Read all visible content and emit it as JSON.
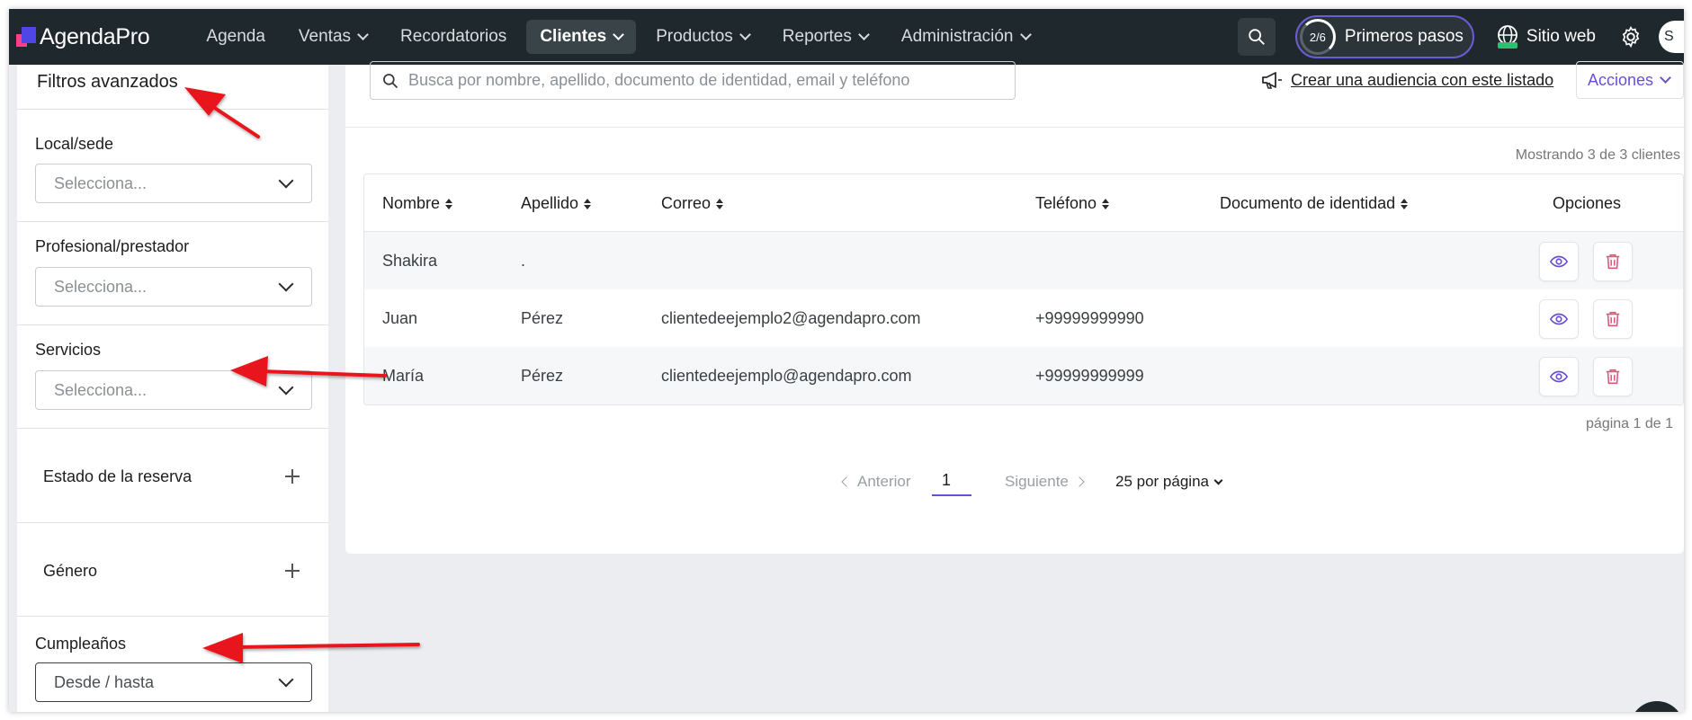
{
  "brand": "AgendaPro",
  "nav": {
    "items": [
      {
        "label": "Agenda",
        "dropdown": false,
        "active": false
      },
      {
        "label": "Ventas",
        "dropdown": true,
        "active": false
      },
      {
        "label": "Recordatorios",
        "dropdown": false,
        "active": false
      },
      {
        "label": "Clientes",
        "dropdown": true,
        "active": true
      },
      {
        "label": "Productos",
        "dropdown": true,
        "active": false
      },
      {
        "label": "Reportes",
        "dropdown": true,
        "active": false
      },
      {
        "label": "Administración",
        "dropdown": true,
        "active": false
      }
    ],
    "steps_progress": "2/6",
    "steps_label": "Primeros pasos",
    "site_label": "Sitio web",
    "avatar_initial": "S"
  },
  "sidebar": {
    "title": "Filtros avanzados",
    "local_label": "Local/sede",
    "local_placeholder": "Selecciona...",
    "profesional_label": "Profesional/prestador",
    "profesional_placeholder": "Selecciona...",
    "servicios_label": "Servicios",
    "servicios_placeholder": "Selecciona...",
    "estado_label": "Estado de la reserva",
    "genero_label": "Género",
    "cumple_label": "Cumpleaños",
    "cumple_value": "Desde / hasta"
  },
  "main": {
    "search_placeholder": "Busca por nombre, apellido, documento de identidad, email y teléfono",
    "audience_link": "Crear una audiencia con este listado",
    "actions_label": "Acciones",
    "showing": "Mostrando 3 de 3 clientes",
    "columns": {
      "nombre": "Nombre",
      "apellido": "Apellido",
      "correo": "Correo",
      "telefono": "Teléfono",
      "documento": "Documento de identidad",
      "opciones": "Opciones"
    },
    "rows": [
      {
        "nombre": "Shakira",
        "apellido": ".",
        "correo": "",
        "telefono": "",
        "documento": ""
      },
      {
        "nombre": "Juan",
        "apellido": "Pérez",
        "correo": "clientedeejemplo2@agendapro.com",
        "telefono": "+99999999990",
        "documento": ""
      },
      {
        "nombre": "María",
        "apellido": "Pérez",
        "correo": "clientedeejemplo@agendapro.com",
        "telefono": "+99999999999",
        "documento": ""
      }
    ],
    "page_info": "página 1 de 1",
    "pager": {
      "prev": "Anterior",
      "current": "1",
      "next": "Siguiente",
      "per_page": "25 por página"
    }
  },
  "colors": {
    "topbar": "#1f282c",
    "accent": "#6b4fd1",
    "danger": "#e0557a",
    "arrow": "#e8141c"
  }
}
